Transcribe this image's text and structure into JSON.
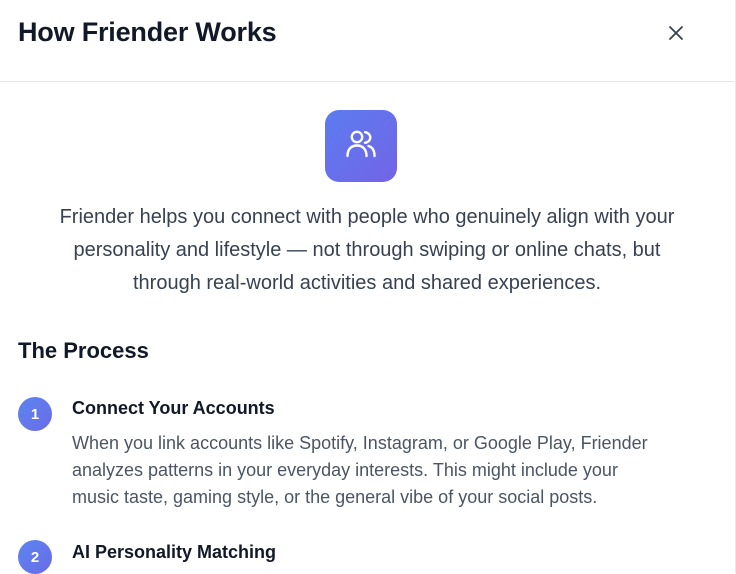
{
  "modal": {
    "title": "How Friender Works",
    "close_icon": "close-icon",
    "hero_icon": "users-icon",
    "intro_lines": [
      "Friender helps you connect with people who genuinely align with your",
      "personality and lifestyle — not through swiping or online chats, but",
      "through real-world activities and shared experiences."
    ]
  },
  "process": {
    "title": "The Process",
    "steps": [
      {
        "number": "1",
        "title": "Connect Your Accounts",
        "description_lines": [
          "When you link accounts like Spotify, Instagram, or Google Play, Friender",
          "analyzes patterns in your everyday interests. This might include your",
          "music taste, gaming style, or the general vibe of your social posts."
        ]
      },
      {
        "number": "2",
        "title": "AI Personality Matching",
        "description_lines": []
      }
    ]
  },
  "colors": {
    "accent_start": "#5b7cf0",
    "accent_end": "#7364e6",
    "title_text": "#111827",
    "body_text": "#374151"
  }
}
